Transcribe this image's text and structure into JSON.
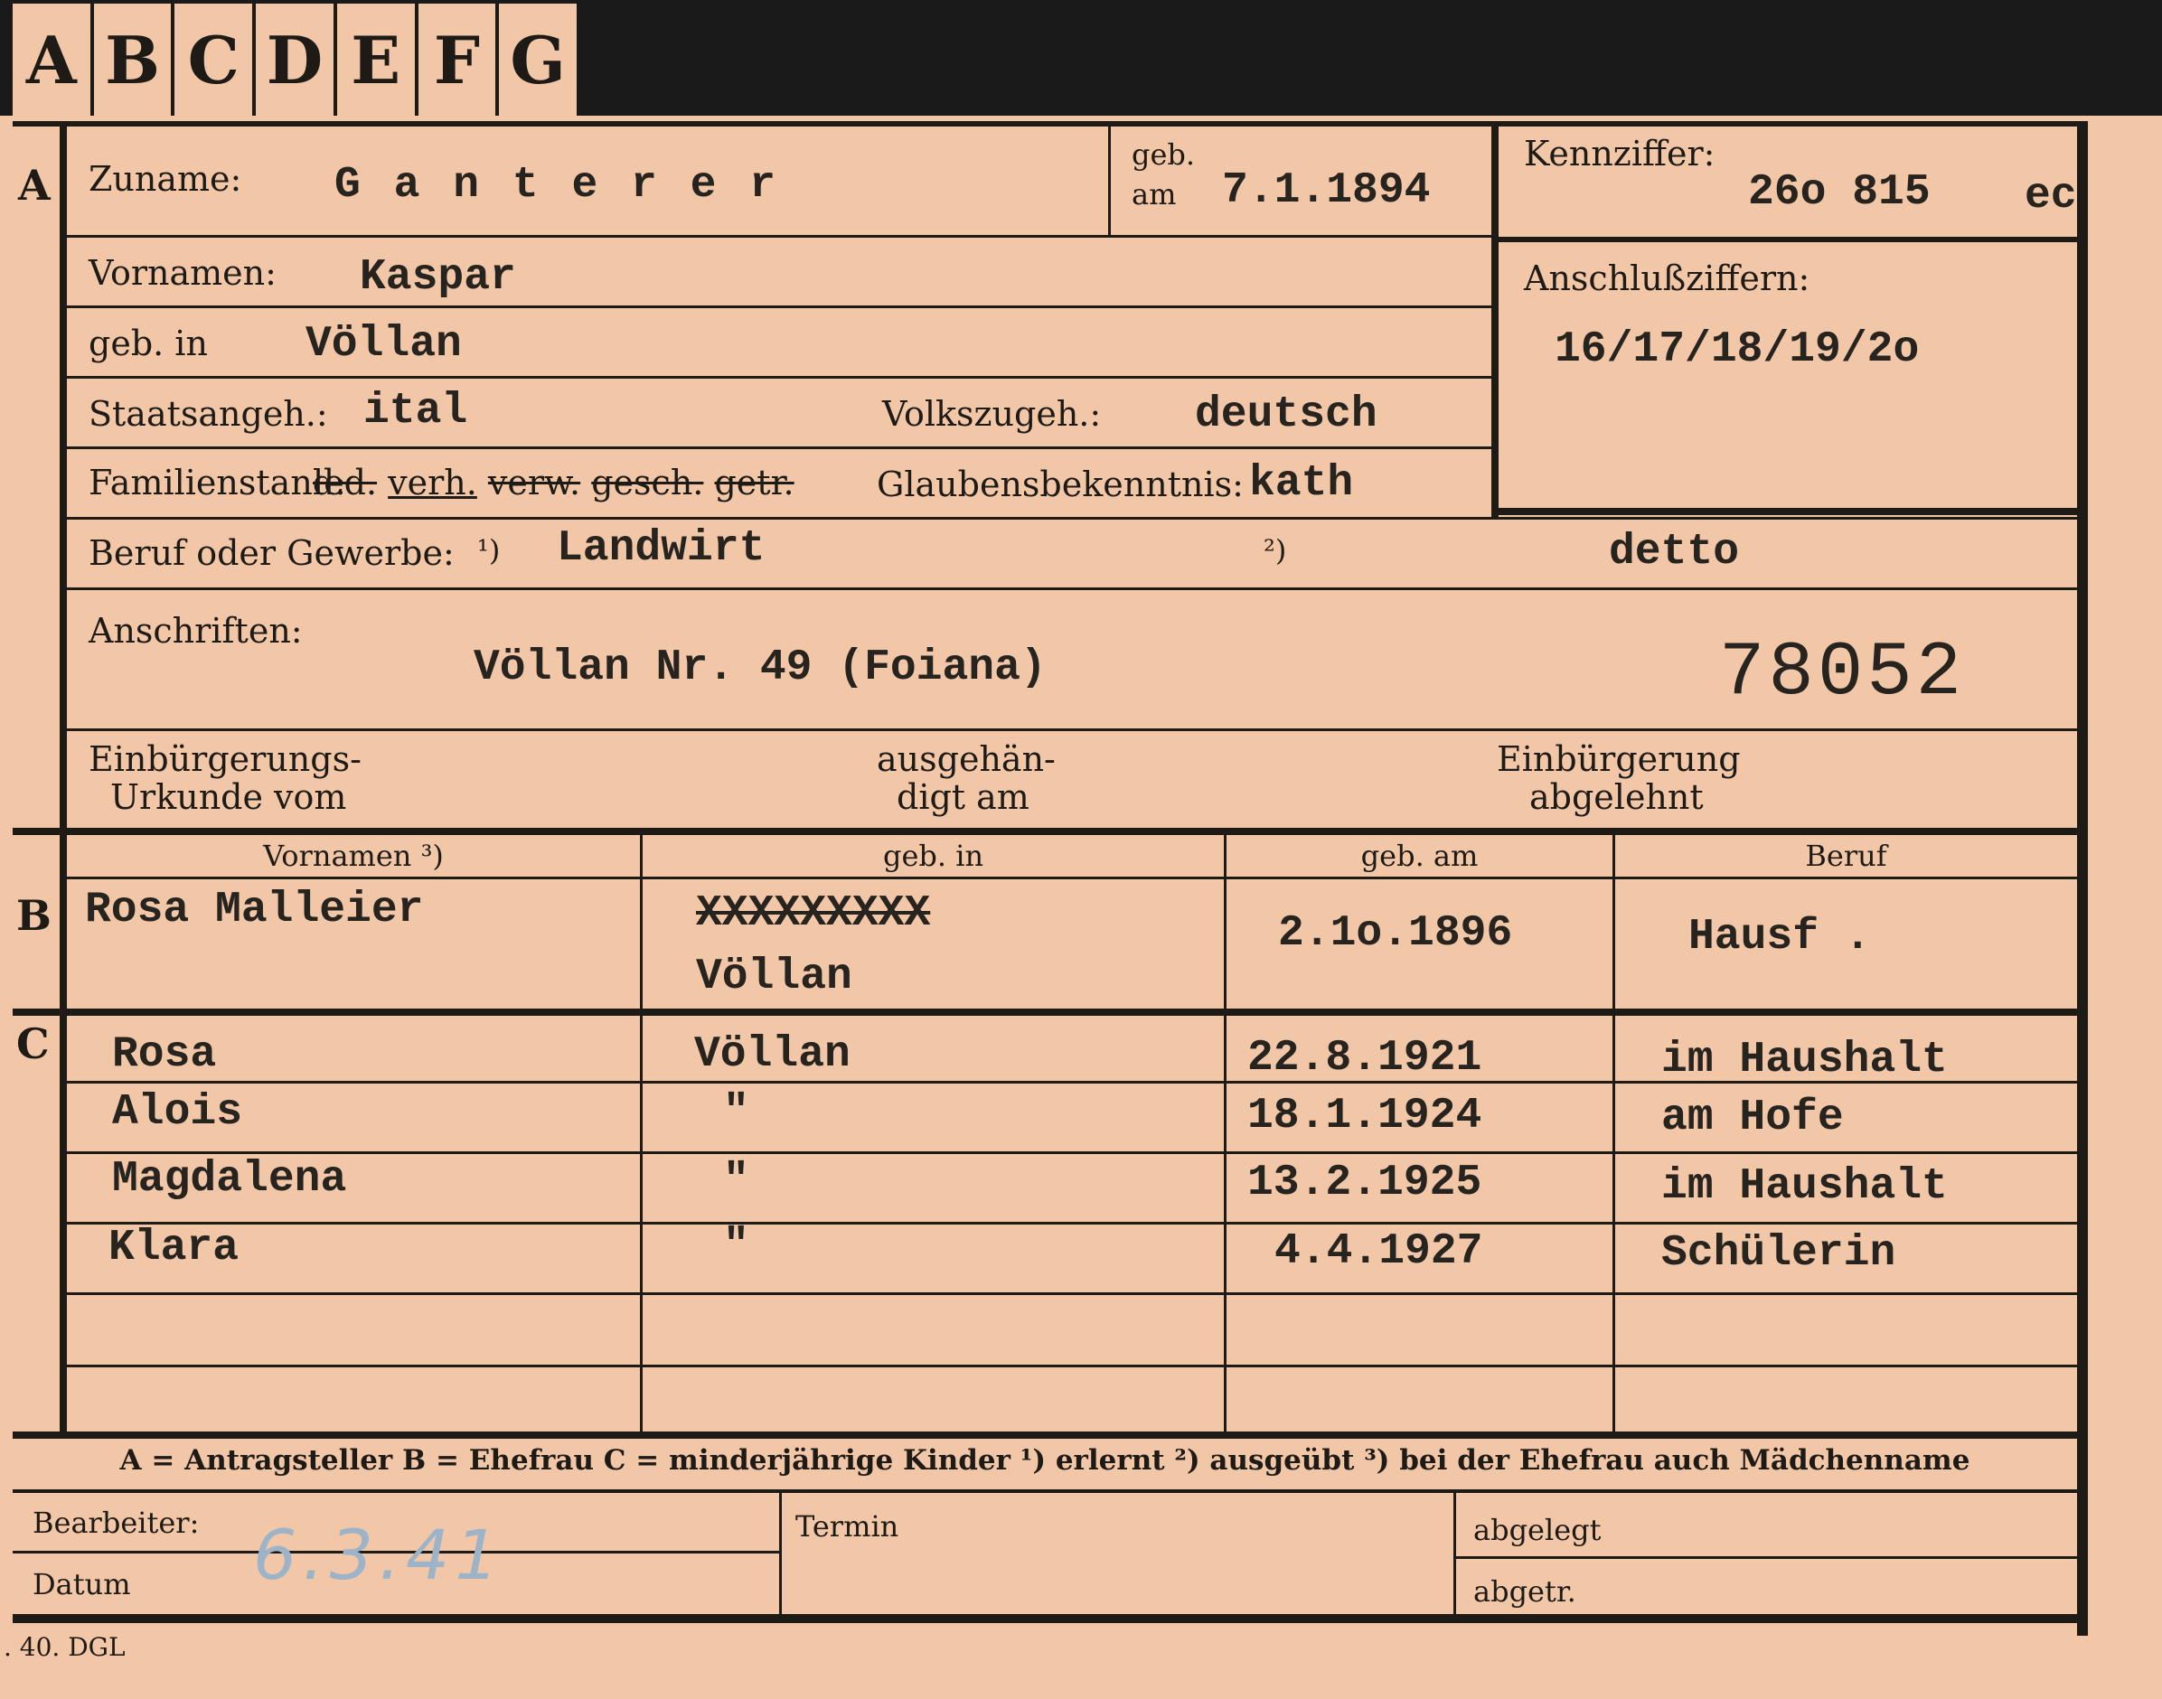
{
  "tabs": [
    "A",
    "B",
    "C",
    "D",
    "E",
    "F",
    "G"
  ],
  "section_a": {
    "marker": "A",
    "zuname_label": "Zuname:",
    "zuname_value": "G a n t e r e r",
    "geb_label_1": "geb.",
    "geb_label_2": "am",
    "geb_value": "7.1.1894",
    "kennziffer_label": "Kennziffer:",
    "kennziffer_value": "26o 815",
    "kennziffer_suffix": "ec",
    "vornamen_label": "Vornamen:",
    "vornamen_value": "Kaspar",
    "anschluss_label": "Anschlußziffern:",
    "anschluss_value": "16/17/18/19/2o",
    "gebin_label": "geb. in",
    "gebin_value": "Völlan",
    "staat_label": "Staatsangeh.:",
    "staat_value": "ital",
    "volk_label": "Volkszugeh.:",
    "volk_value": "deutsch",
    "familien_label": "Familienstand:",
    "familien_options": [
      "led.",
      "verh.",
      "verw.",
      "gesch.",
      "getr."
    ],
    "glauben_label": "Glaubensbekenntnis:",
    "glauben_value": "kath",
    "beruf_label": "Beruf oder Gewerbe:",
    "beruf_mark_1": "¹)",
    "beruf_value_1": "Landwirt",
    "beruf_mark_2": "²)",
    "beruf_value_2": "detto",
    "anschriften_label": "Anschriften:",
    "anschriften_value": "Völlan Nr. 49 (Foiana)",
    "stamp_number": "78052",
    "einb_label_1": "Einbürgerungs-",
    "einb_label_2": "Urkunde vom",
    "ausg_label_1": "ausgehän-",
    "ausg_label_2": "digt am",
    "abgel_label_1": "Einbürgerung",
    "abgel_label_2": "abgelehnt"
  },
  "section_b": {
    "marker": "B",
    "headers": [
      "Vornamen ³)",
      "geb. in",
      "geb. am",
      "Beruf"
    ],
    "name": "Rosa Malleier",
    "struck_place": "XXXXXXXXX",
    "place": "Völlan",
    "date": "2.1o.1896",
    "job": "Hausf ."
  },
  "section_c": {
    "marker": "C",
    "children": [
      {
        "name": "Rosa",
        "place": "Völlan",
        "date": "22.8.1921",
        "job": "im Haushalt"
      },
      {
        "name": "Alois",
        "place": "\"",
        "date": "18.1.1924",
        "job": "am Hofe"
      },
      {
        "name": "Magdalena",
        "place": "\"",
        "date": "13.2.1925",
        "job": "im Haushalt"
      },
      {
        "name": "Klara",
        "place": "\"",
        "date": "4.4.1927",
        "job": "Schülerin"
      }
    ]
  },
  "legend": "A = Antragsteller   B = Ehefrau   C = minderjährige Kinder   ¹) erlernt   ²) ausgeübt   ³) bei der Ehefrau auch Mädchenname",
  "footer": {
    "bearbeiter_label": "Bearbeiter:",
    "datum_label": "Datum",
    "datum_value": "6.3.41",
    "termin_label": "Termin",
    "abgelegt_label": "abgelegt",
    "abgetr_label": "abgetr."
  },
  "print_mark": ". 40. DGL"
}
